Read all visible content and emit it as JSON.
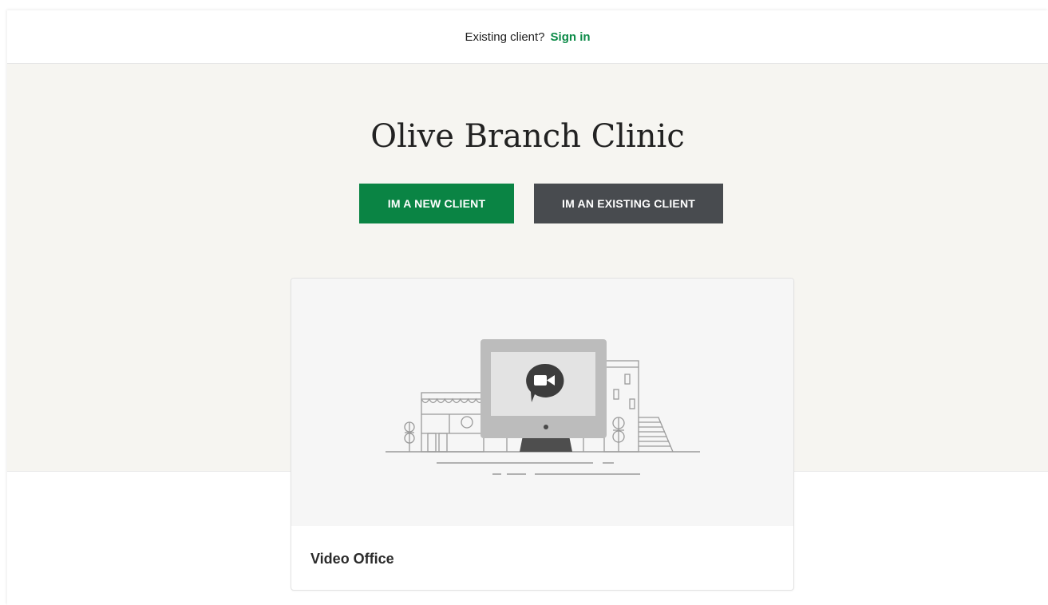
{
  "topbar": {
    "question": "Existing client?",
    "signin_label": "Sign in"
  },
  "hero": {
    "title": "Olive Branch Clinic",
    "new_client_label": "IM A NEW CLIENT",
    "existing_client_label": "IM AN EXISTING CLIENT"
  },
  "location_card": {
    "label": "Video Office",
    "icon": "video-office-illustration"
  },
  "colors": {
    "accent_green": "#0a8444",
    "dark_button": "#484b4f",
    "hero_bg": "#f6f5f1"
  }
}
